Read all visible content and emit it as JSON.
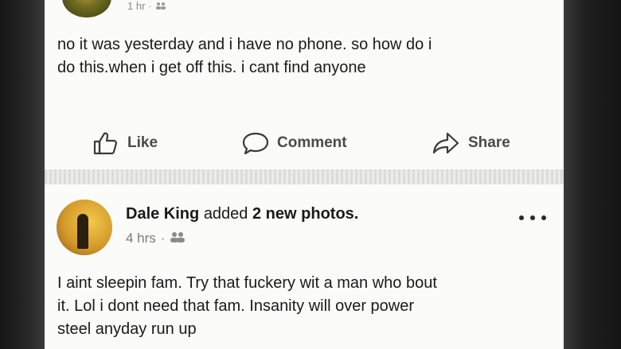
{
  "post_top": {
    "time": "1 hr",
    "text": "no it was yesterday and i have no phone. so how do i\ndo this.when i get off this. i cant find anyone"
  },
  "actions": {
    "like": "Like",
    "comment": "Comment",
    "share": "Share"
  },
  "post_bottom": {
    "author": "Dale King",
    "action_text": "added",
    "action_strong": "2 new photos.",
    "time": "4 hrs",
    "text": "I aint sleepin fam. Try that fuckery wit a man who bout\nit. Lol i dont need that fam. Insanity will over power\nsteel anyday run up"
  },
  "icons": {
    "audience": "friends-icon",
    "like": "thumbs-up-icon",
    "comment": "speech-bubble-icon",
    "share": "share-arrow-icon",
    "more": "more-options-icon"
  }
}
